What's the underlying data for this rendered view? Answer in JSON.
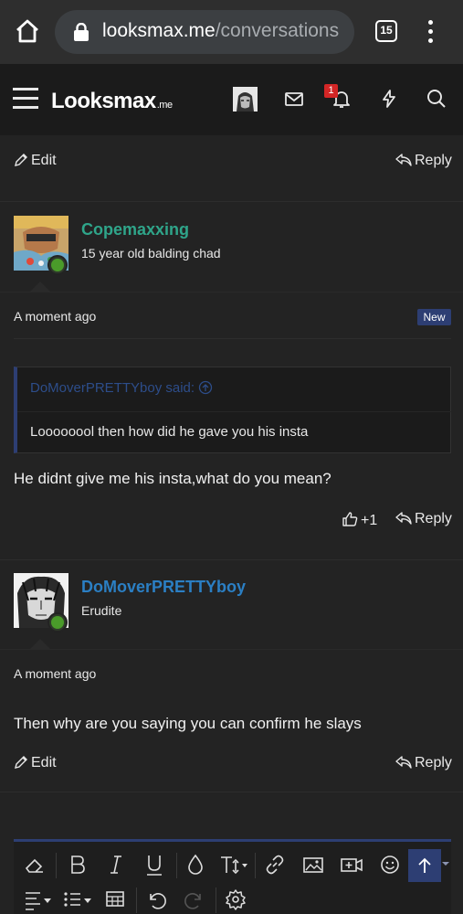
{
  "browser": {
    "url_domain": "looksmax.me",
    "url_path": "/conversations",
    "tab_count": "15"
  },
  "site": {
    "logo_text": "Looksmax",
    "logo_suffix": ".me",
    "notification_count": "1"
  },
  "top_actions": {
    "edit_label": "Edit",
    "reply_label": "Reply"
  },
  "posts": [
    {
      "username": "Copemaxxing",
      "username_color": "#2fa58a",
      "user_title": "15 year old balding chad",
      "timestamp": "A moment ago",
      "badge": "New",
      "quote": {
        "author_line": "DoMoverPRETTYboy said:",
        "text": "Loooooool then how did he gave you his insta"
      },
      "message": "He didnt give me his insta,what do you mean?",
      "reaction_count": "+1",
      "reply_label": "Reply"
    },
    {
      "username": "DoMoverPRETTYboy",
      "username_color": "#2b7fc4",
      "user_title": "Erudite",
      "timestamp": "A moment ago",
      "message": "Then why are you saying you can confirm he slays",
      "edit_label": "Edit",
      "reply_label": "Reply"
    }
  ],
  "colors": {
    "accent": "#2d3e73",
    "online": "#4a9b2a",
    "background": "#232323"
  },
  "editor_toolbar": {
    "icons": [
      "eraser-icon",
      "bold-icon",
      "italic-icon",
      "underline-icon",
      "color-drop-icon",
      "text-size-icon",
      "link-icon",
      "image-icon",
      "video-icon",
      "smiley-icon",
      "scroll-up-icon",
      "align-icon",
      "list-icon",
      "table-icon",
      "undo-icon",
      "redo-icon",
      "settings-icon"
    ]
  }
}
